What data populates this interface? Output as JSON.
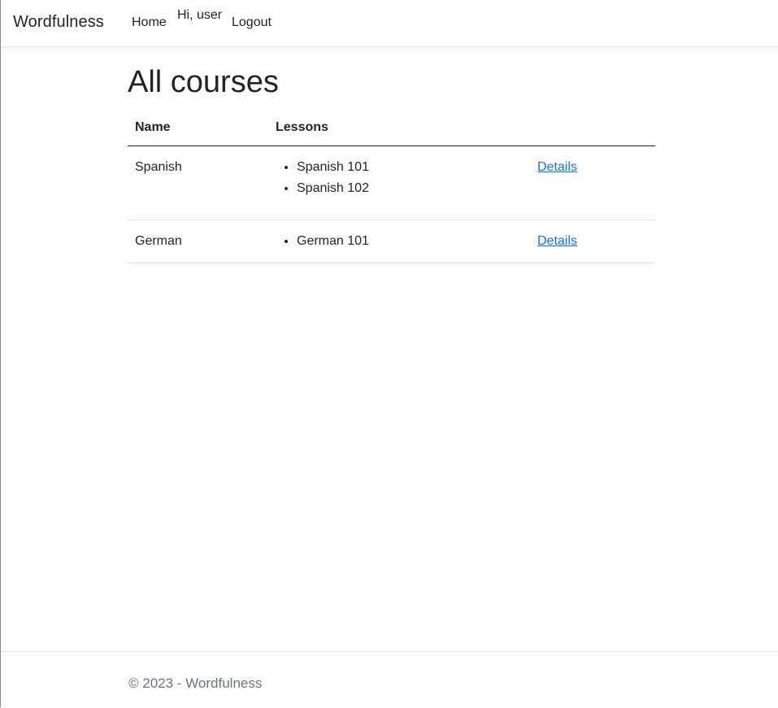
{
  "navbar": {
    "brand": "Wordfulness",
    "home_label": "Home",
    "greeting": "Hi, user",
    "logout_label": "Logout"
  },
  "main": {
    "title": "All courses",
    "table": {
      "headers": [
        "Name",
        "Lessons",
        ""
      ],
      "rows": [
        {
          "name": "Spanish",
          "lessons": [
            "Spanish 101",
            "Spanish 102"
          ],
          "action": "Details"
        },
        {
          "name": "German",
          "lessons": [
            "German 101"
          ],
          "action": "Details"
        }
      ]
    }
  },
  "footer": {
    "text": "© 2023 - Wordfulness"
  },
  "colors": {
    "link": "#0d6efd",
    "text": "#212529",
    "muted": "#6c757d"
  }
}
